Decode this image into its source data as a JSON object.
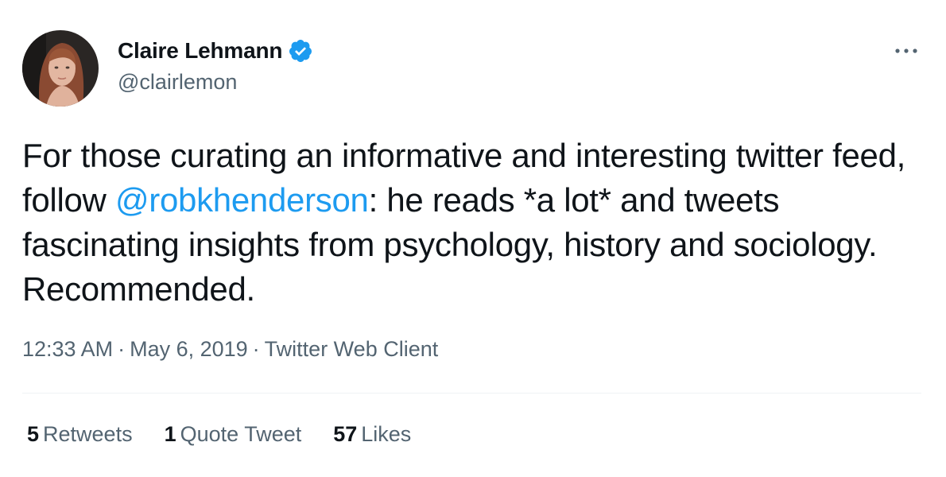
{
  "author": {
    "display_name": "Claire Lehmann",
    "handle": "@clairlemon",
    "verified": true
  },
  "tweet": {
    "text_before_mention": "For those curating an informative and interesting twitter feed, follow ",
    "mention": "@robkhenderson",
    "text_after_mention": ": he reads *a lot* and tweets fascinating insights from psychology, history and sociology. Recommended."
  },
  "meta": {
    "time": "12:33 AM",
    "separator": "·",
    "date": "May 6, 2019",
    "client": "Twitter Web Client"
  },
  "stats": [
    {
      "count": "5",
      "label": "Retweets"
    },
    {
      "count": "1",
      "label": "Quote Tweet"
    },
    {
      "count": "57",
      "label": "Likes"
    }
  ],
  "colors": {
    "accent": "#1d9bf0",
    "text": "#0f1419",
    "secondary": "#536471",
    "divider": "#eff3f4"
  },
  "icons": {
    "verified": "verified-badge-icon",
    "more": "more-horizontal-icon"
  }
}
